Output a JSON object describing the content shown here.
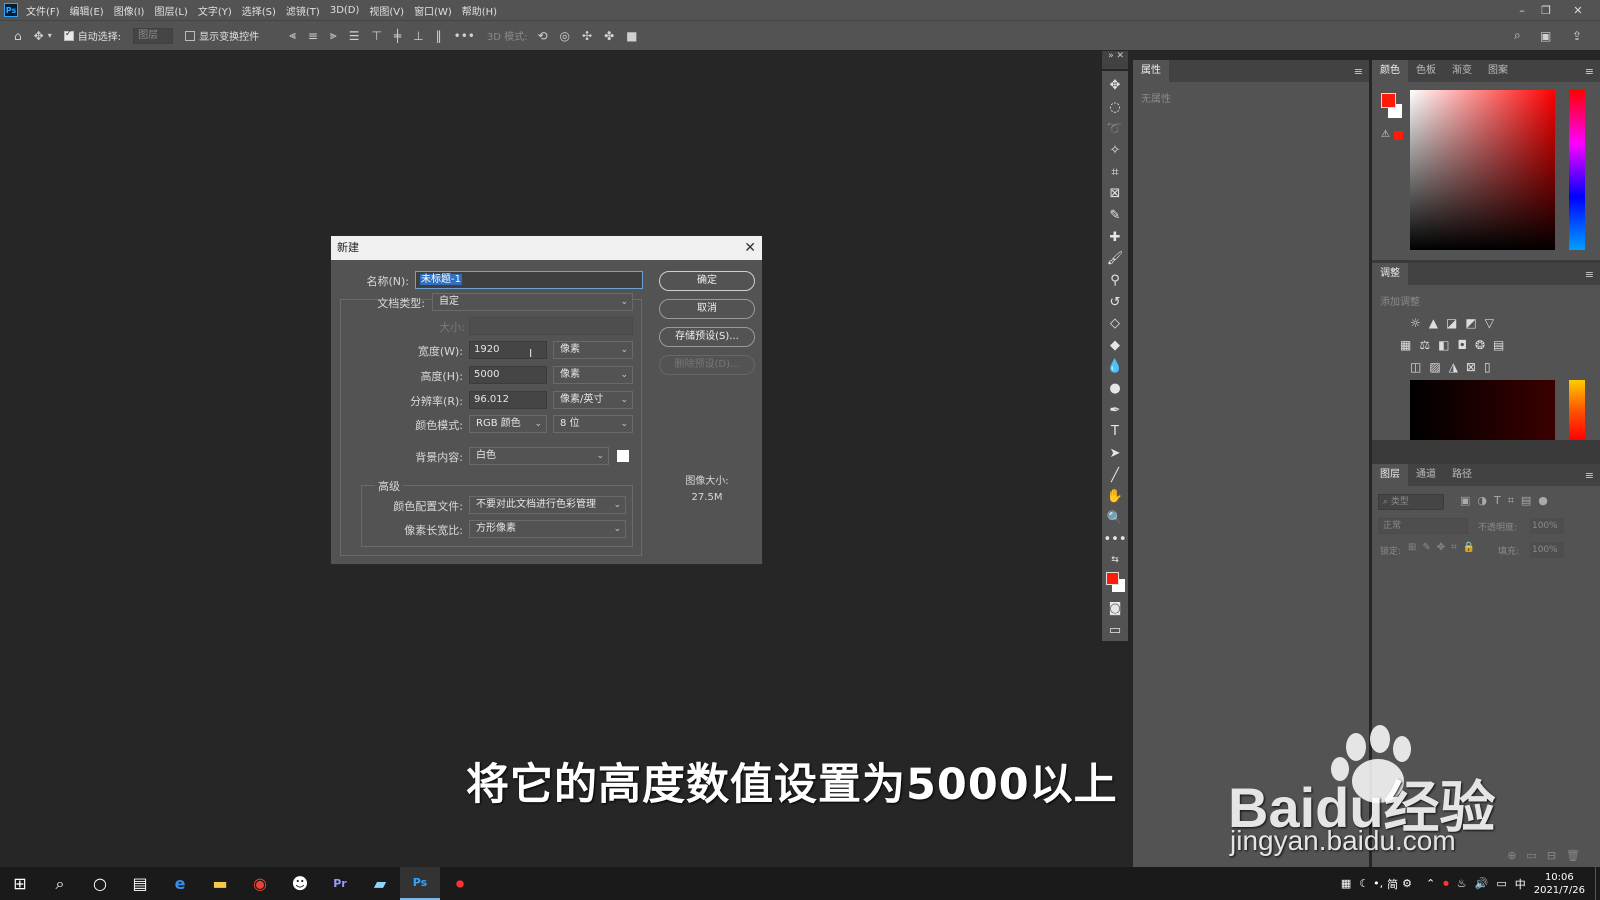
{
  "menubar": {
    "logo": "Ps",
    "items": [
      "文件(F)",
      "编辑(E)",
      "图像(I)",
      "图层(L)",
      "文字(Y)",
      "选择(S)",
      "滤镜(T)",
      "3D(D)",
      "视图(V)",
      "窗口(W)",
      "帮助(H)"
    ]
  },
  "optbar": {
    "auto_select_label": "自动选择:",
    "auto_select_value": "图层",
    "show_transform_label": "显示变换控件",
    "mode_3d_label": "3D 模式:"
  },
  "properties_panel": {
    "tab": "属性",
    "empty_text": "无属性"
  },
  "color_panel": {
    "tabs": [
      "颜色",
      "色板",
      "渐变",
      "图案"
    ],
    "foreground": "#ff1a0a",
    "background": "#ffffff"
  },
  "adjust_panel": {
    "tab": "调整",
    "add_label": "添加调整"
  },
  "layers_panel": {
    "tabs": [
      "图层",
      "通道",
      "路径"
    ],
    "search_placeholder": "类型",
    "blend_mode": "正常",
    "opacity_label": "不透明度:",
    "opacity_value": "100%",
    "lock_label": "锁定:",
    "fill_label": "填充:",
    "fill_value": "100%"
  },
  "dialog": {
    "title": "新建",
    "name_label": "名称(N):",
    "name_value": "未标题-1",
    "doc_type_label": "文档类型:",
    "doc_type_value": "自定",
    "size_label": "大小:",
    "width_label": "宽度(W):",
    "width_value": "1920",
    "width_unit": "像素",
    "height_label": "高度(H):",
    "height_value": "5000",
    "height_unit": "像素",
    "resolution_label": "分辨率(R):",
    "resolution_value": "96.012",
    "resolution_unit": "像素/英寸",
    "color_mode_label": "颜色模式:",
    "color_mode_value": "RGB 颜色",
    "bit_depth_value": "8 位",
    "bg_label": "背景内容:",
    "bg_value": "白色",
    "advanced_label": "高级",
    "profile_label": "颜色配置文件:",
    "profile_value": "不要对此文档进行色彩管理",
    "pixel_aspect_label": "像素长宽比:",
    "pixel_aspect_value": "方形像素",
    "ok_button": "确定",
    "cancel_button": "取消",
    "save_preset_button": "存储预设(S)...",
    "delete_preset_button": "删除预设(D)...",
    "image_size_label": "图像大小:",
    "image_size_value": "27.5M"
  },
  "caption": "将它的高度数值设置为5000以上",
  "watermark": {
    "brand": "Baidu经验",
    "url": "jingyan.baidu.com"
  },
  "taskbar": {
    "ime_text": "简",
    "lang": "中",
    "time": "10:06",
    "date": "2021/7/26"
  }
}
